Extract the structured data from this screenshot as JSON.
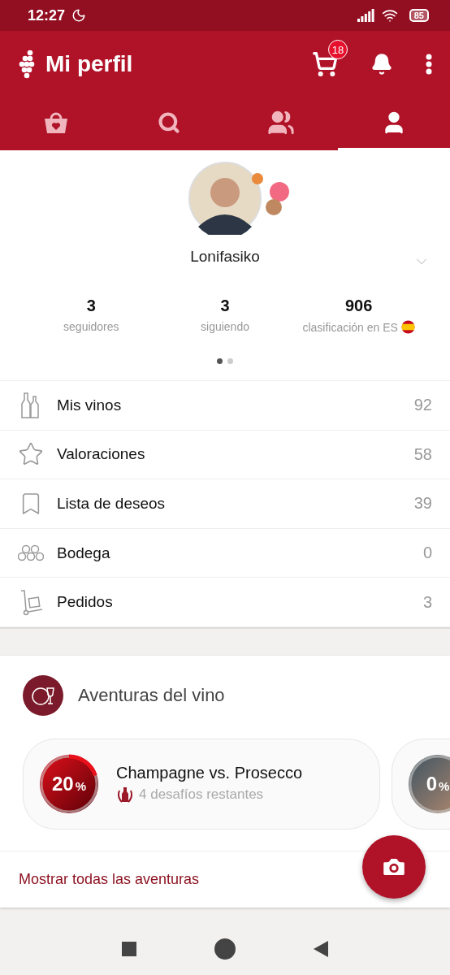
{
  "status_bar": {
    "time": "12:27",
    "battery": "85"
  },
  "app_bar": {
    "title": "Mi perfil",
    "cart_count": "18"
  },
  "tabs": [
    {
      "kind": "shop",
      "selected": false
    },
    {
      "kind": "search",
      "selected": false
    },
    {
      "kind": "friends",
      "selected": false
    },
    {
      "kind": "profile",
      "selected": true
    }
  ],
  "profile": {
    "username": "Lonifasiko",
    "stats": [
      {
        "value": "3",
        "label": "seguidores",
        "flag": false
      },
      {
        "value": "3",
        "label": "siguiendo",
        "flag": false
      },
      {
        "value": "906",
        "label": "clasificación en ES",
        "flag": true
      }
    ],
    "pages": [
      {
        "selected": true
      },
      {
        "selected": false
      }
    ]
  },
  "menu": [
    {
      "kind": "bottles",
      "label": "Mis vinos",
      "count": "92"
    },
    {
      "kind": "stars",
      "label": "Valoraciones",
      "count": "58"
    },
    {
      "kind": "bookmark",
      "label": "Lista de deseos",
      "count": "39"
    },
    {
      "kind": "cellar",
      "label": "Bodega",
      "count": "0"
    },
    {
      "kind": "orders",
      "label": "Pedidos",
      "count": "3"
    }
  ],
  "adventures": {
    "title": "Aventuras del vino",
    "cards": [
      {
        "percent": "20",
        "unit": "%",
        "level": 0.2,
        "title": "Champagne vs. Prosecco",
        "subtitle": "4 desafíos restantes"
      },
      {
        "percent": "0",
        "unit": "%",
        "level": 0
      }
    ],
    "link": "Mostrar todas las aventuras"
  }
}
